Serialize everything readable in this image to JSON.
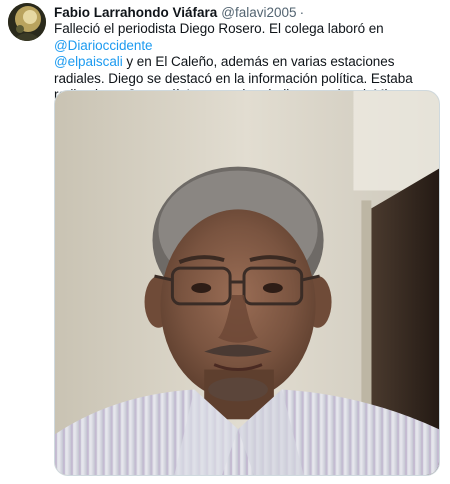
{
  "tweet": {
    "author": {
      "display_name": "Fabio Larrahondo Viáfara",
      "handle": "@falavi2005",
      "separator": "·"
    },
    "text": {
      "part1": "Falleció el periodista Diego Rosero. El colega laboró en ",
      "mention1": "@Diarioccidente",
      "part2": " ",
      "mention2": "@elpaiscali",
      "part3": "  y en El Caleño, además en varias estaciones radiales. Diego se destacó en la información política. Estaba radicado en Jamundí. Luto en el periodismo regional. Mis condolencias a su familia."
    },
    "media": {
      "type": "photo",
      "subject": "portrait-of-man-with-glasses"
    }
  },
  "colors": {
    "text": "#0f1419",
    "secondary": "#536471",
    "link": "#1d9bf0",
    "border": "#cfd9de"
  }
}
